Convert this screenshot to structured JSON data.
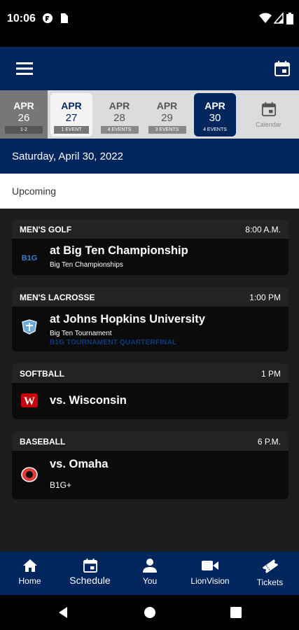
{
  "status_bar": {
    "time": "10:06"
  },
  "app_bar": {
    "menu_icon": "hamburger-menu-icon",
    "calendar_icon": "calendar-icon"
  },
  "date_strip": [
    {
      "month": "APR",
      "day": "26",
      "badge": "1-2"
    },
    {
      "month": "APR",
      "day": "27",
      "badge": "1 EVENT"
    },
    {
      "month": "APR",
      "day": "28",
      "badge": "4 EVENTS"
    },
    {
      "month": "APR",
      "day": "29",
      "badge": "3 EVENTS"
    },
    {
      "month": "APR",
      "day": "30",
      "badge": "4 EVENTS",
      "selected": true
    }
  ],
  "calendar_button": {
    "label": "Calendar"
  },
  "selected_date": "Saturday, April 30, 2022",
  "section_title": "Upcoming",
  "events": [
    {
      "sport": "MEN'S GOLF",
      "time": "8:00 A.M.",
      "opponent": "at Big Ten Championship",
      "subtitle": "Big Ten Championships",
      "logo": "big-ten-logo"
    },
    {
      "sport": "MEN'S LACROSSE",
      "time": "1:00 PM",
      "opponent": "at Johns Hopkins University",
      "subtitle": "Big Ten Tournament",
      "detail": "B1G TOURNAMENT QUARTERFINAL",
      "logo": "johns-hopkins-logo"
    },
    {
      "sport": "SOFTBALL",
      "time": "1 PM",
      "opponent": "vs. Wisconsin",
      "logo": "wisconsin-logo"
    },
    {
      "sport": "BASEBALL",
      "time": "6 P.M.",
      "opponent": "vs. Omaha",
      "subtitle": "B1G+",
      "logo": "omaha-logo"
    }
  ],
  "bottom_nav": [
    {
      "label": "Home",
      "icon": "home-icon"
    },
    {
      "label": "Schedule",
      "icon": "schedule-icon",
      "selected": true
    },
    {
      "label": "You",
      "icon": "person-icon"
    },
    {
      "label": "LionVision",
      "icon": "video-camera-icon"
    },
    {
      "label": "Tickets",
      "icon": "ticket-icon"
    }
  ],
  "colors": {
    "primary": "#00265d",
    "strip": "#dcdcdc",
    "card": "#0b0b0b",
    "background": "#1c1c1c"
  }
}
